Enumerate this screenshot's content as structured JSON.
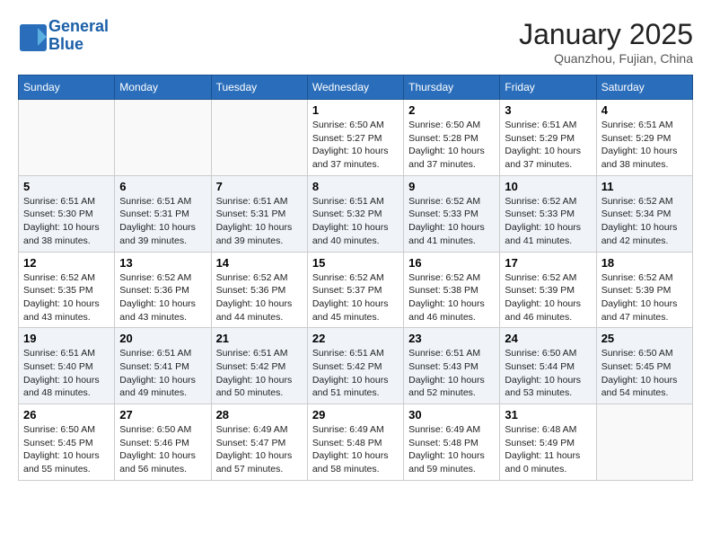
{
  "header": {
    "logo_line1": "General",
    "logo_line2": "Blue",
    "month": "January 2025",
    "location": "Quanzhou, Fujian, China"
  },
  "weekdays": [
    "Sunday",
    "Monday",
    "Tuesday",
    "Wednesday",
    "Thursday",
    "Friday",
    "Saturday"
  ],
  "weeks": [
    [
      {
        "day": "",
        "info": ""
      },
      {
        "day": "",
        "info": ""
      },
      {
        "day": "",
        "info": ""
      },
      {
        "day": "1",
        "info": "Sunrise: 6:50 AM\nSunset: 5:27 PM\nDaylight: 10 hours\nand 37 minutes."
      },
      {
        "day": "2",
        "info": "Sunrise: 6:50 AM\nSunset: 5:28 PM\nDaylight: 10 hours\nand 37 minutes."
      },
      {
        "day": "3",
        "info": "Sunrise: 6:51 AM\nSunset: 5:29 PM\nDaylight: 10 hours\nand 37 minutes."
      },
      {
        "day": "4",
        "info": "Sunrise: 6:51 AM\nSunset: 5:29 PM\nDaylight: 10 hours\nand 38 minutes."
      }
    ],
    [
      {
        "day": "5",
        "info": "Sunrise: 6:51 AM\nSunset: 5:30 PM\nDaylight: 10 hours\nand 38 minutes."
      },
      {
        "day": "6",
        "info": "Sunrise: 6:51 AM\nSunset: 5:31 PM\nDaylight: 10 hours\nand 39 minutes."
      },
      {
        "day": "7",
        "info": "Sunrise: 6:51 AM\nSunset: 5:31 PM\nDaylight: 10 hours\nand 39 minutes."
      },
      {
        "day": "8",
        "info": "Sunrise: 6:51 AM\nSunset: 5:32 PM\nDaylight: 10 hours\nand 40 minutes."
      },
      {
        "day": "9",
        "info": "Sunrise: 6:52 AM\nSunset: 5:33 PM\nDaylight: 10 hours\nand 41 minutes."
      },
      {
        "day": "10",
        "info": "Sunrise: 6:52 AM\nSunset: 5:33 PM\nDaylight: 10 hours\nand 41 minutes."
      },
      {
        "day": "11",
        "info": "Sunrise: 6:52 AM\nSunset: 5:34 PM\nDaylight: 10 hours\nand 42 minutes."
      }
    ],
    [
      {
        "day": "12",
        "info": "Sunrise: 6:52 AM\nSunset: 5:35 PM\nDaylight: 10 hours\nand 43 minutes."
      },
      {
        "day": "13",
        "info": "Sunrise: 6:52 AM\nSunset: 5:36 PM\nDaylight: 10 hours\nand 43 minutes."
      },
      {
        "day": "14",
        "info": "Sunrise: 6:52 AM\nSunset: 5:36 PM\nDaylight: 10 hours\nand 44 minutes."
      },
      {
        "day": "15",
        "info": "Sunrise: 6:52 AM\nSunset: 5:37 PM\nDaylight: 10 hours\nand 45 minutes."
      },
      {
        "day": "16",
        "info": "Sunrise: 6:52 AM\nSunset: 5:38 PM\nDaylight: 10 hours\nand 46 minutes."
      },
      {
        "day": "17",
        "info": "Sunrise: 6:52 AM\nSunset: 5:39 PM\nDaylight: 10 hours\nand 46 minutes."
      },
      {
        "day": "18",
        "info": "Sunrise: 6:52 AM\nSunset: 5:39 PM\nDaylight: 10 hours\nand 47 minutes."
      }
    ],
    [
      {
        "day": "19",
        "info": "Sunrise: 6:51 AM\nSunset: 5:40 PM\nDaylight: 10 hours\nand 48 minutes."
      },
      {
        "day": "20",
        "info": "Sunrise: 6:51 AM\nSunset: 5:41 PM\nDaylight: 10 hours\nand 49 minutes."
      },
      {
        "day": "21",
        "info": "Sunrise: 6:51 AM\nSunset: 5:42 PM\nDaylight: 10 hours\nand 50 minutes."
      },
      {
        "day": "22",
        "info": "Sunrise: 6:51 AM\nSunset: 5:42 PM\nDaylight: 10 hours\nand 51 minutes."
      },
      {
        "day": "23",
        "info": "Sunrise: 6:51 AM\nSunset: 5:43 PM\nDaylight: 10 hours\nand 52 minutes."
      },
      {
        "day": "24",
        "info": "Sunrise: 6:50 AM\nSunset: 5:44 PM\nDaylight: 10 hours\nand 53 minutes."
      },
      {
        "day": "25",
        "info": "Sunrise: 6:50 AM\nSunset: 5:45 PM\nDaylight: 10 hours\nand 54 minutes."
      }
    ],
    [
      {
        "day": "26",
        "info": "Sunrise: 6:50 AM\nSunset: 5:45 PM\nDaylight: 10 hours\nand 55 minutes."
      },
      {
        "day": "27",
        "info": "Sunrise: 6:50 AM\nSunset: 5:46 PM\nDaylight: 10 hours\nand 56 minutes."
      },
      {
        "day": "28",
        "info": "Sunrise: 6:49 AM\nSunset: 5:47 PM\nDaylight: 10 hours\nand 57 minutes."
      },
      {
        "day": "29",
        "info": "Sunrise: 6:49 AM\nSunset: 5:48 PM\nDaylight: 10 hours\nand 58 minutes."
      },
      {
        "day": "30",
        "info": "Sunrise: 6:49 AM\nSunset: 5:48 PM\nDaylight: 10 hours\nand 59 minutes."
      },
      {
        "day": "31",
        "info": "Sunrise: 6:48 AM\nSunset: 5:49 PM\nDaylight: 11 hours\nand 0 minutes."
      },
      {
        "day": "",
        "info": ""
      }
    ]
  ]
}
